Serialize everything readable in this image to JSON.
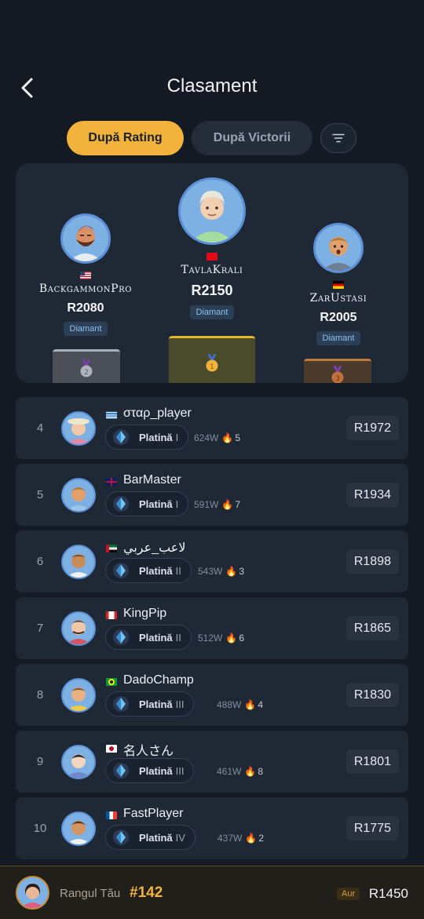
{
  "header": {
    "title": "Clasament"
  },
  "tabs": [
    {
      "label": "După Rating",
      "active": true
    },
    {
      "label": "După Victorii",
      "active": false
    }
  ],
  "podium": {
    "first": {
      "name": "TavlaKrali",
      "rating": "R2150",
      "tier": "Diamant",
      "flag": "TR"
    },
    "second": {
      "name": "BackgammonPro",
      "rating": "R2080",
      "tier": "Diamant",
      "flag": "US"
    },
    "third": {
      "name": "ZarUstasi",
      "rating": "R2005",
      "tier": "Diamant",
      "flag": "DE"
    }
  },
  "players": [
    {
      "rank": "4",
      "flag": "GR",
      "name": "σταρ_player",
      "tier": "Platină",
      "level": "I",
      "wins": "624W",
      "streak": "5",
      "rating": "R1972"
    },
    {
      "rank": "5",
      "flag": "GB",
      "name": "BarMaster",
      "tier": "Platină",
      "level": "I",
      "wins": "591W",
      "streak": "7",
      "rating": "R1934"
    },
    {
      "rank": "6",
      "flag": "AE",
      "name": "لاعب_عربي",
      "tier": "Platină",
      "level": "II",
      "wins": "543W",
      "streak": "3",
      "rating": "R1898"
    },
    {
      "rank": "7",
      "flag": "CA",
      "name": "KingPip",
      "tier": "Platină",
      "level": "II",
      "wins": "512W",
      "streak": "6",
      "rating": "R1865"
    },
    {
      "rank": "8",
      "flag": "BR",
      "name": "DadoChamp",
      "tier": "Platină",
      "level": "III",
      "wins": "488W",
      "streak": "4",
      "rating": "R1830"
    },
    {
      "rank": "9",
      "flag": "JP",
      "name": "名人さん",
      "tier": "Platină",
      "level": "III",
      "wins": "461W",
      "streak": "8",
      "rating": "R1801"
    },
    {
      "rank": "10",
      "flag": "FR",
      "name": "FastPlayer",
      "tier": "Platină",
      "level": "IV",
      "wins": "437W",
      "streak": "2",
      "rating": "R1775"
    }
  ],
  "footer": {
    "label": "Rangul Tău",
    "rank": "#142",
    "tier": "Aur",
    "rating": "R1450"
  },
  "colors": {
    "accent": "#f2b33d",
    "background": "#131a24",
    "card": "#1f2835",
    "ring": "#5b8fd6"
  }
}
